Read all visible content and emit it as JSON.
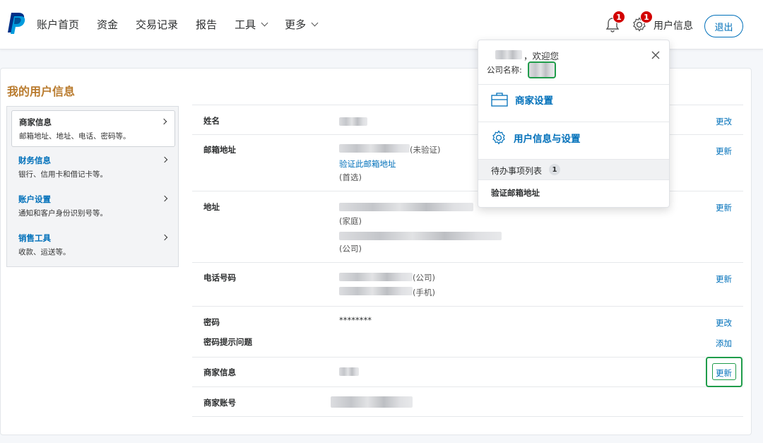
{
  "nav": {
    "items": [
      {
        "label": "账户首页"
      },
      {
        "label": "资金"
      },
      {
        "label": "交易记录"
      },
      {
        "label": "报告"
      },
      {
        "label": "工具",
        "dropdown": true
      },
      {
        "label": "更多",
        "dropdown": true
      }
    ],
    "notifications_count": "1",
    "settings_count": "1",
    "user_label": "用户信息",
    "logout_label": "退出"
  },
  "page": {
    "title": "我的用户信息"
  },
  "sidebar": {
    "items": [
      {
        "title": "商家信息",
        "desc": "邮箱地址、地址、电话、密码等。"
      },
      {
        "title": "财务信息",
        "desc": "银行、信用卡和借记卡等。"
      },
      {
        "title": "账户设置",
        "desc": "通知和客户身份识别号等。"
      },
      {
        "title": "销售工具",
        "desc": "收款、运送等。"
      }
    ]
  },
  "rows": {
    "name": {
      "label": "姓名",
      "action": "更改"
    },
    "email": {
      "label": "邮箱地址",
      "status": "(未验证)",
      "verify_link": "验证此邮箱地址",
      "tag": "(首选)",
      "action": "更新"
    },
    "address": {
      "label": "地址",
      "tag_home": "(家庭)",
      "tag_company": "(公司)",
      "action": "更新"
    },
    "phone": {
      "label": "电话号码",
      "tag_company": "(公司)",
      "tag_mobile": "(手机)",
      "action": "更新"
    },
    "password": {
      "label": "密码",
      "value": "********",
      "action": "更改",
      "hint_label": "密码提示问题",
      "hint_action": "添加"
    },
    "merchant_info": {
      "label": "商家信息",
      "action": "更新"
    },
    "merchant_account": {
      "label": "商家账号"
    }
  },
  "dropdown": {
    "welcome": "，欢迎您",
    "company_label": "公司名称:",
    "menu": [
      {
        "label": "商家设置",
        "icon": "briefcase-icon"
      },
      {
        "label": "用户信息与设置",
        "icon": "gear-icon"
      }
    ],
    "todo_label": "待办事项列表",
    "todo_count": "1",
    "todo_items": [
      {
        "label": "验证邮箱地址"
      }
    ]
  },
  "colors": {
    "brand_blue": "#0070ba",
    "title_gold": "#b97b2e",
    "badge_red": "#d20000",
    "highlight_green": "#1f9c4a"
  }
}
